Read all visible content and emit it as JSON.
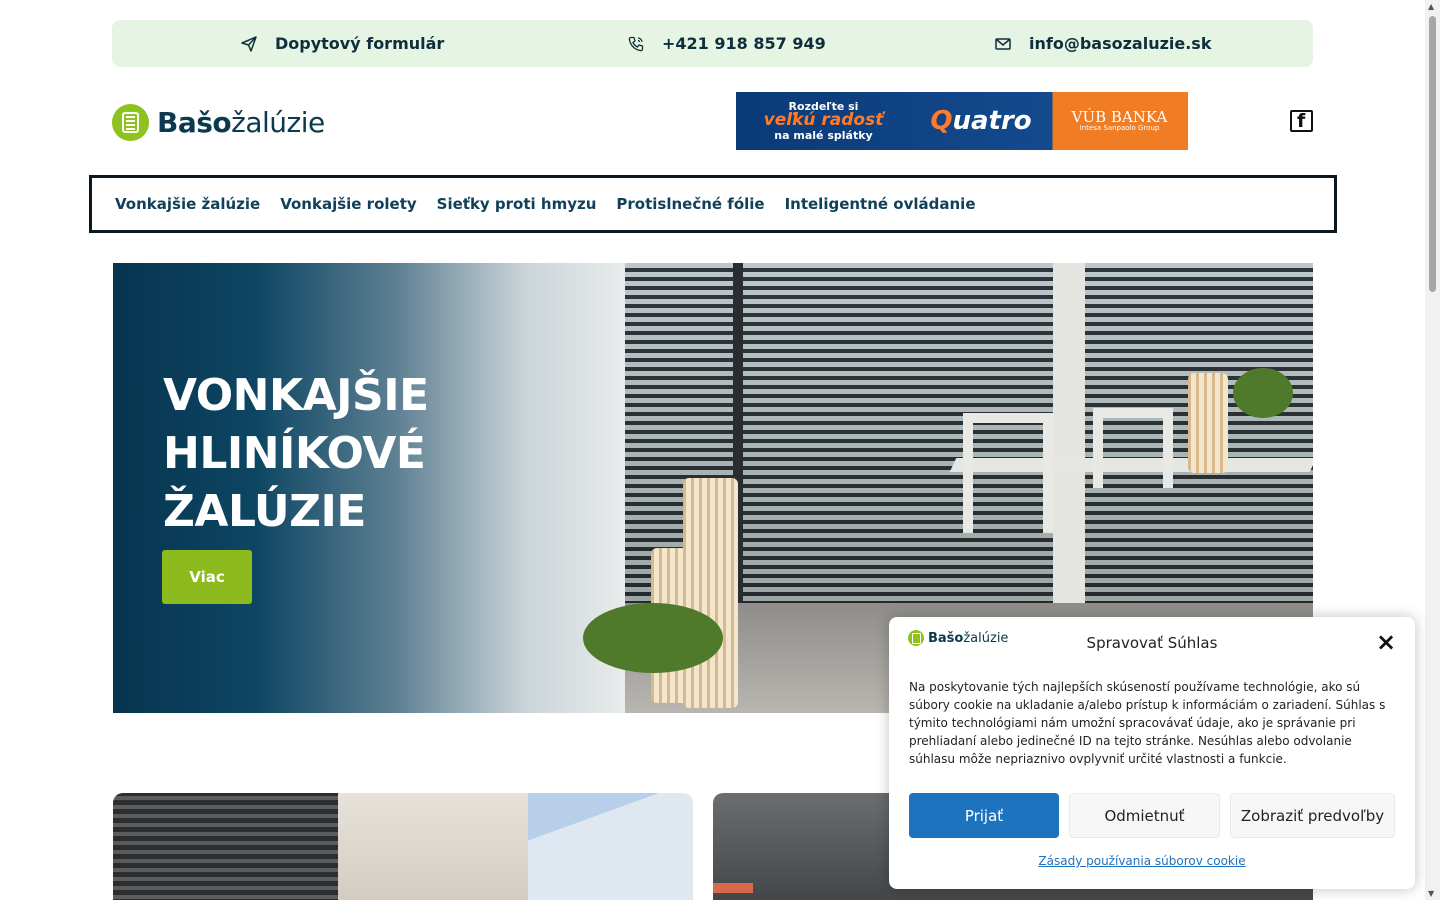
{
  "topbar": {
    "form_label": "Dopytový formulár",
    "phone": "+421 918 857 949",
    "email": "info@basozaluzie.sk"
  },
  "header": {
    "logo_bold": "Bašo",
    "logo_regular": "žalúzie",
    "banner": {
      "line1": "Rozdeľte si",
      "line2": "veľkú radosť",
      "line3": "na malé splátky",
      "brand_q": "Q",
      "brand_rest": "uatro",
      "bank": "VÚB BANKA",
      "bank_sub": "Intesa Sanpaolo Group"
    },
    "social_icon": "f"
  },
  "nav": {
    "items": [
      {
        "label": "Vonkajšie žalúzie"
      },
      {
        "label": "Vonkajšie rolety"
      },
      {
        "label": "Sieťky proti hmyzu"
      },
      {
        "label": "Protislnečné fólie"
      },
      {
        "label": "Inteligentné ovládanie"
      }
    ]
  },
  "hero": {
    "title_line1": "VONKAJŠIE",
    "title_line2": "HLINÍKOVÉ",
    "title_line3": "ŽALÚZIE",
    "button_label": "Viac"
  },
  "cookie": {
    "logo_bold": "Bašo",
    "logo_regular": "žalúzie",
    "title": "Spravovať Súhlas",
    "close_icon": "×",
    "text": "Na poskytovanie tých najlepších skúseností používame technológie, ako sú súbory cookie na ukladanie a/alebo prístup k informáciám o zariadení. Súhlas s týmito technológiami nám umožní spracovávať údaje, ako je správanie pri prehliadaní alebo jedinečné ID na tejto stránke. Nesúhlas alebo odvolanie súhlasu môže nepriaznivo ovplyvniť určité vlastnosti a funkcie.",
    "accept_label": "Prijať",
    "deny_label": "Odmietnuť",
    "prefs_label": "Zobraziť predvoľby",
    "policy_link": "Zásady používania súborov cookie"
  },
  "colors": {
    "brand_green": "#8dc21f",
    "brand_navy": "#0b3a4f",
    "topbar_bg": "#e6f5e3",
    "accept_blue": "#1e73be"
  }
}
